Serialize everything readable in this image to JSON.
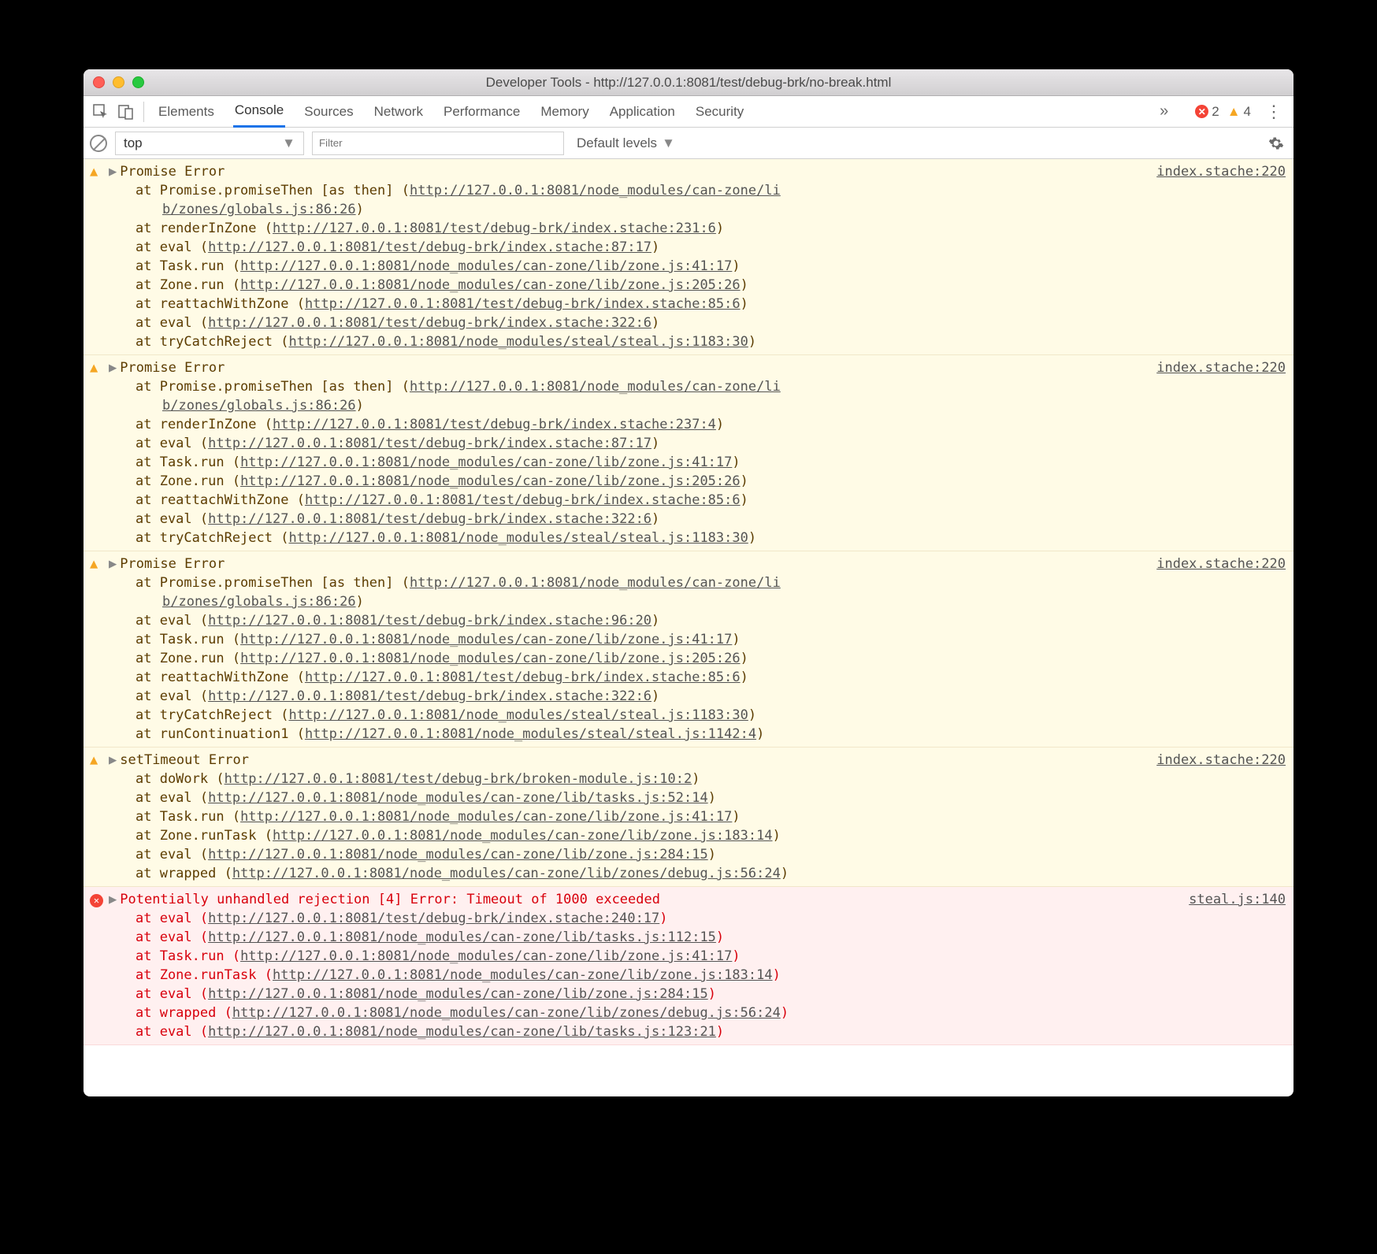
{
  "window": {
    "title": "Developer Tools - http://127.0.0.1:8081/test/debug-brk/no-break.html"
  },
  "tabs": {
    "items": [
      "Elements",
      "Console",
      "Sources",
      "Network",
      "Performance",
      "Memory",
      "Application",
      "Security"
    ],
    "activeIndex": 1,
    "overflow": "»"
  },
  "badges": {
    "errorCount": "2",
    "warnCount": "4"
  },
  "filterbar": {
    "context": "top",
    "filterPlaceholder": "Filter",
    "levels": "Default levels"
  },
  "entries": [
    {
      "type": "warn",
      "title": "Promise Error",
      "source": "index.stache:220",
      "stack": [
        {
          "pre": "    at Promise.promiseThen [as then] (",
          "url": "http://127.0.0.1:8081/node_modules/can-zone/lib/zones/globals.js:86:26",
          "post": ")",
          "wrap": true
        },
        {
          "pre": "    at renderInZone (",
          "url": "http://127.0.0.1:8081/test/debug-brk/index.stache:231:6",
          "post": ")"
        },
        {
          "pre": "    at eval (",
          "url": "http://127.0.0.1:8081/test/debug-brk/index.stache:87:17",
          "post": ")"
        },
        {
          "pre": "    at Task.run (",
          "url": "http://127.0.0.1:8081/node_modules/can-zone/lib/zone.js:41:17",
          "post": ")"
        },
        {
          "pre": "    at Zone.run (",
          "url": "http://127.0.0.1:8081/node_modules/can-zone/lib/zone.js:205:26",
          "post": ")"
        },
        {
          "pre": "    at reattachWithZone (",
          "url": "http://127.0.0.1:8081/test/debug-brk/index.stache:85:6",
          "post": ")"
        },
        {
          "pre": "    at eval (",
          "url": "http://127.0.0.1:8081/test/debug-brk/index.stache:322:6",
          "post": ")"
        },
        {
          "pre": "    at tryCatchReject (",
          "url": "http://127.0.0.1:8081/node_modules/steal/steal.js:1183:30",
          "post": ")"
        }
      ]
    },
    {
      "type": "warn",
      "title": "Promise Error",
      "source": "index.stache:220",
      "stack": [
        {
          "pre": "    at Promise.promiseThen [as then] (",
          "url": "http://127.0.0.1:8081/node_modules/can-zone/lib/zones/globals.js:86:26",
          "post": ")",
          "wrap": true
        },
        {
          "pre": "    at renderInZone (",
          "url": "http://127.0.0.1:8081/test/debug-brk/index.stache:237:4",
          "post": ")"
        },
        {
          "pre": "    at eval (",
          "url": "http://127.0.0.1:8081/test/debug-brk/index.stache:87:17",
          "post": ")"
        },
        {
          "pre": "    at Task.run (",
          "url": "http://127.0.0.1:8081/node_modules/can-zone/lib/zone.js:41:17",
          "post": ")"
        },
        {
          "pre": "    at Zone.run (",
          "url": "http://127.0.0.1:8081/node_modules/can-zone/lib/zone.js:205:26",
          "post": ")"
        },
        {
          "pre": "    at reattachWithZone (",
          "url": "http://127.0.0.1:8081/test/debug-brk/index.stache:85:6",
          "post": ")"
        },
        {
          "pre": "    at eval (",
          "url": "http://127.0.0.1:8081/test/debug-brk/index.stache:322:6",
          "post": ")"
        },
        {
          "pre": "    at tryCatchReject (",
          "url": "http://127.0.0.1:8081/node_modules/steal/steal.js:1183:30",
          "post": ")"
        }
      ]
    },
    {
      "type": "warn",
      "title": "Promise Error",
      "source": "index.stache:220",
      "stack": [
        {
          "pre": "    at Promise.promiseThen [as then] (",
          "url": "http://127.0.0.1:8081/node_modules/can-zone/lib/zones/globals.js:86:26",
          "post": ")",
          "wrap": true
        },
        {
          "pre": "    at eval (",
          "url": "http://127.0.0.1:8081/test/debug-brk/index.stache:96:20",
          "post": ")"
        },
        {
          "pre": "    at Task.run (",
          "url": "http://127.0.0.1:8081/node_modules/can-zone/lib/zone.js:41:17",
          "post": ")"
        },
        {
          "pre": "    at Zone.run (",
          "url": "http://127.0.0.1:8081/node_modules/can-zone/lib/zone.js:205:26",
          "post": ")"
        },
        {
          "pre": "    at reattachWithZone (",
          "url": "http://127.0.0.1:8081/test/debug-brk/index.stache:85:6",
          "post": ")"
        },
        {
          "pre": "    at eval (",
          "url": "http://127.0.0.1:8081/test/debug-brk/index.stache:322:6",
          "post": ")"
        },
        {
          "pre": "    at tryCatchReject (",
          "url": "http://127.0.0.1:8081/node_modules/steal/steal.js:1183:30",
          "post": ")"
        },
        {
          "pre": "    at runContinuation1 (",
          "url": "http://127.0.0.1:8081/node_modules/steal/steal.js:1142:4",
          "post": ")"
        }
      ]
    },
    {
      "type": "warn",
      "title": "setTimeout Error",
      "source": "index.stache:220",
      "stack": [
        {
          "pre": "    at doWork (",
          "url": "http://127.0.0.1:8081/test/debug-brk/broken-module.js:10:2",
          "post": ")"
        },
        {
          "pre": "    at eval (",
          "url": "http://127.0.0.1:8081/node_modules/can-zone/lib/tasks.js:52:14",
          "post": ")"
        },
        {
          "pre": "    at Task.run (",
          "url": "http://127.0.0.1:8081/node_modules/can-zone/lib/zone.js:41:17",
          "post": ")"
        },
        {
          "pre": "    at Zone.runTask (",
          "url": "http://127.0.0.1:8081/node_modules/can-zone/lib/zone.js:183:14",
          "post": ")"
        },
        {
          "pre": "    at eval (",
          "url": "http://127.0.0.1:8081/node_modules/can-zone/lib/zone.js:284:15",
          "post": ")"
        },
        {
          "pre": "    at wrapped (",
          "url": "http://127.0.0.1:8081/node_modules/can-zone/lib/zones/debug.js:56:24",
          "post": ")"
        }
      ]
    },
    {
      "type": "err",
      "title": "Potentially unhandled rejection [4] Error: Timeout of 1000 exceeded",
      "source": "steal.js:140",
      "stack": [
        {
          "pre": "    at eval (",
          "url": "http://127.0.0.1:8081/test/debug-brk/index.stache:240:17",
          "post": ")"
        },
        {
          "pre": "    at eval (",
          "url": "http://127.0.0.1:8081/node_modules/can-zone/lib/tasks.js:112:15",
          "post": ")"
        },
        {
          "pre": "    at Task.run (",
          "url": "http://127.0.0.1:8081/node_modules/can-zone/lib/zone.js:41:17",
          "post": ")"
        },
        {
          "pre": "    at Zone.runTask (",
          "url": "http://127.0.0.1:8081/node_modules/can-zone/lib/zone.js:183:14",
          "post": ")"
        },
        {
          "pre": "    at eval (",
          "url": "http://127.0.0.1:8081/node_modules/can-zone/lib/zone.js:284:15",
          "post": ")"
        },
        {
          "pre": "    at wrapped (",
          "url": "http://127.0.0.1:8081/node_modules/can-zone/lib/zones/debug.js:56:24",
          "post": ")"
        },
        {
          "pre": "    at eval (",
          "url": "http://127.0.0.1:8081/node_modules/can-zone/lib/tasks.js:123:21",
          "post": ")"
        }
      ]
    }
  ]
}
